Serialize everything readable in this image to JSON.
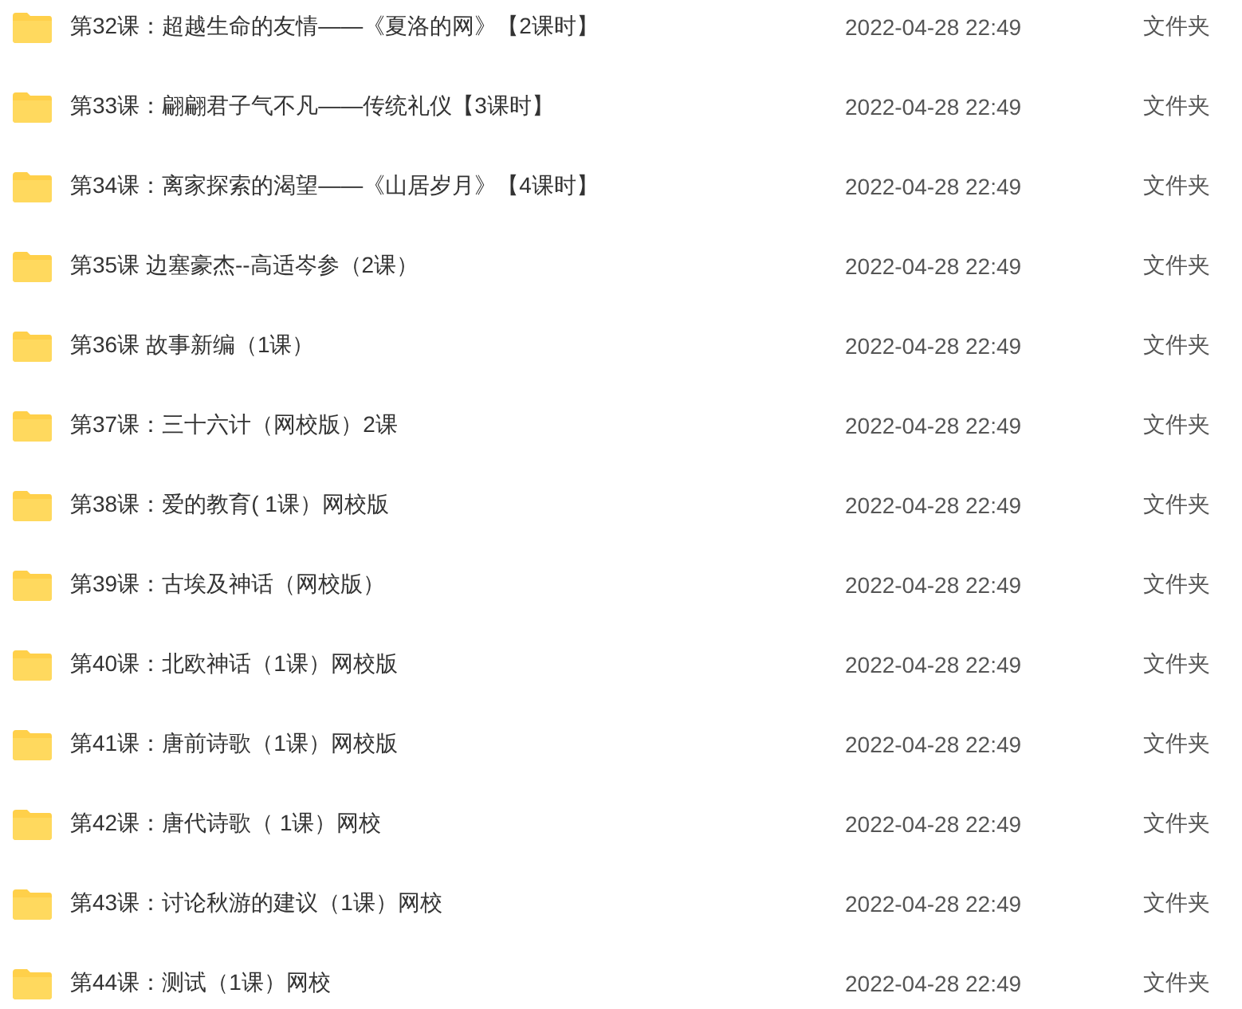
{
  "files": [
    {
      "name": "第32课：超越生命的友情——《夏洛的网》【2课时】",
      "modified": "2022-04-28 22:49",
      "type": "文件夹"
    },
    {
      "name": "第33课：翩翩君子气不凡——传统礼仪【3课时】",
      "modified": "2022-04-28 22:49",
      "type": "文件夹"
    },
    {
      "name": "第34课：离家探索的渴望——《山居岁月》【4课时】",
      "modified": "2022-04-28 22:49",
      "type": "文件夹"
    },
    {
      "name": "第35课 边塞豪杰--高适岑参（2课）",
      "modified": "2022-04-28 22:49",
      "type": "文件夹"
    },
    {
      "name": "第36课 故事新编（1课）",
      "modified": "2022-04-28 22:49",
      "type": "文件夹"
    },
    {
      "name": "第37课：三十六计（网校版）2课",
      "modified": "2022-04-28 22:49",
      "type": "文件夹"
    },
    {
      "name": "第38课：爱的教育( 1课）网校版",
      "modified": "2022-04-28 22:49",
      "type": "文件夹"
    },
    {
      "name": "第39课：古埃及神话（网校版）",
      "modified": "2022-04-28 22:49",
      "type": "文件夹"
    },
    {
      "name": "第40课：北欧神话（1课）网校版",
      "modified": "2022-04-28 22:49",
      "type": "文件夹"
    },
    {
      "name": "第41课：唐前诗歌（1课）网校版",
      "modified": "2022-04-28 22:49",
      "type": "文件夹"
    },
    {
      "name": "第42课：唐代诗歌（ 1课）网校",
      "modified": "2022-04-28 22:49",
      "type": "文件夹"
    },
    {
      "name": "第43课：讨论秋游的建议（1课）网校",
      "modified": "2022-04-28 22:49",
      "type": "文件夹"
    },
    {
      "name": "第44课：测试（1课）网校",
      "modified": "2022-04-28 22:49",
      "type": "文件夹"
    }
  ]
}
